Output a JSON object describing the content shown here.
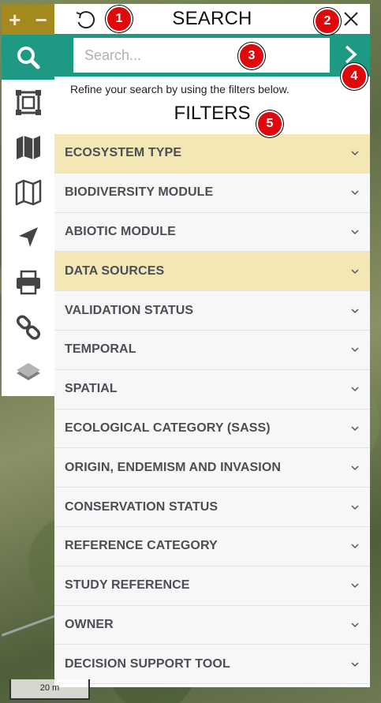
{
  "zoom": {
    "in_label": "+",
    "out_label": "−"
  },
  "toolbar": {
    "items": [
      {
        "name": "search",
        "icon": "search-icon",
        "active": true
      },
      {
        "name": "select-area",
        "icon": "select-area-icon",
        "active": false
      },
      {
        "name": "map-layers",
        "icon": "map-filled-icon",
        "active": false
      },
      {
        "name": "base-map",
        "icon": "map-outline-icon",
        "active": false
      },
      {
        "name": "locate",
        "icon": "location-arrow-icon",
        "active": false
      },
      {
        "name": "print",
        "icon": "printer-icon",
        "active": false
      },
      {
        "name": "link",
        "icon": "link-icon",
        "active": false
      },
      {
        "name": "layers",
        "icon": "layers-icon",
        "active": false
      }
    ]
  },
  "panel": {
    "title": "SEARCH",
    "search_placeholder": "Search...",
    "hint": "Refine your search by using the filters below.",
    "filters_title": "FILTERS",
    "filters": [
      {
        "label": "ECOSYSTEM TYPE",
        "highlight": true
      },
      {
        "label": "BIODIVERSITY MODULE",
        "highlight": false
      },
      {
        "label": "ABIOTIC MODULE",
        "highlight": false
      },
      {
        "label": "DATA SOURCES",
        "highlight": true
      },
      {
        "label": "VALIDATION STATUS",
        "highlight": false
      },
      {
        "label": "TEMPORAL",
        "highlight": false
      },
      {
        "label": "SPATIAL",
        "highlight": false
      },
      {
        "label": "ECOLOGICAL CATEGORY (SASS)",
        "highlight": false
      },
      {
        "label": "ORIGIN, ENDEMISM AND INVASION",
        "highlight": false
      },
      {
        "label": "CONSERVATION STATUS",
        "highlight": false
      },
      {
        "label": "REFERENCE CATEGORY",
        "highlight": false
      },
      {
        "label": "STUDY REFERENCE",
        "highlight": false
      },
      {
        "label": "OWNER",
        "highlight": false
      },
      {
        "label": "DECISION SUPPORT TOOL",
        "highlight": false
      }
    ]
  },
  "markers": [
    "1",
    "2",
    "3",
    "4",
    "5"
  ],
  "scale": {
    "label": "20 m"
  },
  "colors": {
    "accent": "#1e9a84",
    "highlight": "#f3e7b5",
    "marker": "#e0080b",
    "zoom_bar": "#a48a1e"
  }
}
